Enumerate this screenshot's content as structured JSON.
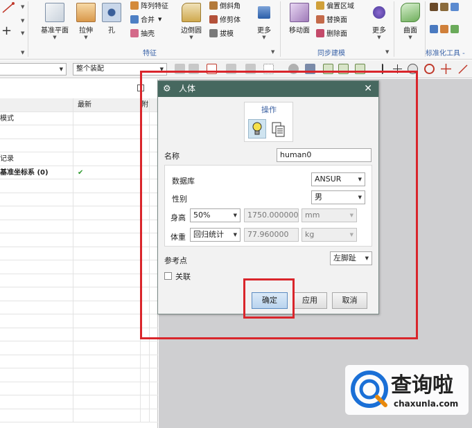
{
  "ribbon": {
    "features_group": {
      "label": "特征",
      "datum_plane": "基准平面",
      "extrude": "拉伸",
      "hole": "孔",
      "pattern_feature": "阵列特征",
      "unite": "合并",
      "shell": "抽壳",
      "edge_blend": "边倒圆",
      "chamfer": "倒斜角",
      "trim_body": "修剪体",
      "draft": "拔模",
      "more": "更多"
    },
    "sync_group": {
      "label": "同步建模",
      "move_face": "移动面",
      "offset_region": "偏置区域",
      "replace_face": "替换面",
      "delete_face": "删除面",
      "more": "更多"
    },
    "surface": "曲面",
    "standard_tools": "标准化工具 -"
  },
  "command_bar": {
    "assembly_scope": "整个装配"
  },
  "navigator": {
    "header_latest": "最新",
    "header_col3": "附",
    "rows": [
      {
        "name": "模式",
        "latest": ""
      },
      {
        "name": "",
        "latest": ""
      },
      {
        "name": "",
        "latest": ""
      },
      {
        "name": "记录",
        "latest": ""
      },
      {
        "name": "基准坐标系 (0)",
        "latest": "✔"
      }
    ]
  },
  "dialog": {
    "title": "人体",
    "section_operation": "操作",
    "name_label": "名称",
    "name_value": "human0",
    "database_label": "数据库",
    "database_value": "ANSUR",
    "gender_label": "性别",
    "gender_value": "男",
    "height_label": "身高",
    "height_percentile": "50%",
    "height_value": "1750.000000",
    "height_unit": "mm",
    "weight_label": "体重",
    "weight_method": "回归统计",
    "weight_value": "77.960000",
    "weight_unit": "kg",
    "reference_point_label": "参考点",
    "reference_point_value": "左脚趾",
    "associative_label": "关联",
    "ok_label": "确定",
    "apply_label": "应用",
    "cancel_label": "取消"
  },
  "watermark": {
    "brand": "查询啦",
    "url": "chaxunla.com"
  },
  "colors": {
    "dialog_title": "#46685f",
    "highlight_red": "#d9252b",
    "watermark_blue": "#1a6fd6"
  }
}
